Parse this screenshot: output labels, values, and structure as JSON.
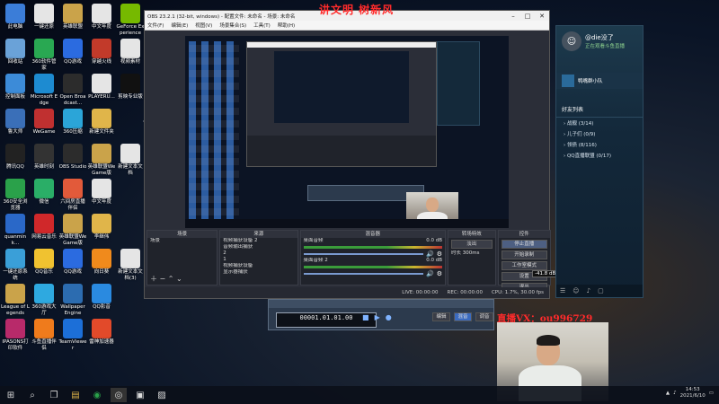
{
  "watermark_top": "讲文明 树新风",
  "watermark_vx": "直播VX：ou996729",
  "desktop_icons": [
    {
      "label": "此电脑",
      "icon": "computer-icon",
      "color": "#3b7dd8"
    },
    {
      "label": "一键还原",
      "icon": "file-icon",
      "color": "#e5e5e5"
    },
    {
      "label": "英雄联盟",
      "icon": "game-icon",
      "color": "#caa34a"
    },
    {
      "label": "中文年度",
      "icon": "file-icon",
      "color": "#e5e5e5"
    },
    {
      "label": "GeForce Experience",
      "icon": "nvidia-icon",
      "color": "#76b900"
    },
    {
      "label": "回收站",
      "icon": "recycle-bin-icon",
      "color": "#6aa2d8"
    },
    {
      "label": "360软件管家",
      "icon": "app-icon",
      "color": "#29a852"
    },
    {
      "label": "QQ游戏",
      "icon": "app-icon",
      "color": "#2b6be0"
    },
    {
      "label": "穿越火线",
      "icon": "game-icon",
      "color": "#c23a2a"
    },
    {
      "label": "视频素材",
      "icon": "file-icon",
      "color": "#e5e5e5"
    },
    {
      "label": "控制面板",
      "icon": "control-panel-icon",
      "color": "#3c8bd8"
    },
    {
      "label": "Microsoft Edge",
      "icon": "edge-icon",
      "color": "#1d8bd1"
    },
    {
      "label": "Open Broadcast...",
      "icon": "obs-icon",
      "color": "#2c2c2c"
    },
    {
      "label": "PLAYERU...",
      "icon": "file-icon",
      "color": "#e5e5e5"
    },
    {
      "label": "剪映专业版",
      "icon": "capcut-icon",
      "color": "#111111"
    },
    {
      "label": "鲁大师",
      "icon": "app-icon",
      "color": "#3a6fb8"
    },
    {
      "label": "WeGame",
      "icon": "app-icon",
      "color": "#c03030"
    },
    {
      "label": "360压缩",
      "icon": "app-icon",
      "color": "#2ba5d8"
    },
    {
      "label": "新建文件夹",
      "icon": "folder-icon",
      "color": "#e0b54a"
    },
    {
      "label": "",
      "icon": "blank",
      "color": "transparent"
    },
    {
      "label": "腾讯QQ",
      "icon": "qq-icon",
      "color": "#222"
    },
    {
      "label": "英雄时刻",
      "icon": "app-icon",
      "color": "#333"
    },
    {
      "label": "OBS Studio",
      "icon": "obs-icon",
      "color": "#2c2c2c"
    },
    {
      "label": "英雄联盟WeGame版",
      "icon": "game-icon",
      "color": "#caa34a"
    },
    {
      "label": "新建文本文档",
      "icon": "file-icon",
      "color": "#e5e5e5"
    },
    {
      "label": "360安全浏览器",
      "icon": "app-icon",
      "color": "#2aa14a"
    },
    {
      "label": "微信",
      "icon": "wechat-icon",
      "color": "#2aae67"
    },
    {
      "label": "六间房直播伴侣",
      "icon": "app-icon",
      "color": "#e25a3a"
    },
    {
      "label": "中文年度",
      "icon": "file-icon",
      "color": "#e5e5e5"
    },
    {
      "label": "",
      "icon": "blank",
      "color": "transparent"
    },
    {
      "label": "quanmink...",
      "icon": "app-icon",
      "color": "#2a68c8"
    },
    {
      "label": "网易云音乐",
      "icon": "music-icon",
      "color": "#d0282a"
    },
    {
      "label": "英雄联盟WeGame版",
      "icon": "game-icon",
      "color": "#caa34a"
    },
    {
      "label": "李继伟",
      "icon": "file-icon",
      "color": "#e0b54a"
    },
    {
      "label": "",
      "icon": "blank",
      "color": "transparent"
    },
    {
      "label": "一键还原系统",
      "icon": "app-icon",
      "color": "#3a9fd8"
    },
    {
      "label": "QQ音乐",
      "icon": "music-icon",
      "color": "#f0c230"
    },
    {
      "label": "QQ游戏",
      "icon": "app-icon",
      "color": "#2b6be0"
    },
    {
      "label": "向日葵",
      "icon": "app-icon",
      "color": "#f08a1c"
    },
    {
      "label": "新建文本文档(3)",
      "icon": "file-icon",
      "color": "#e5e5e5"
    },
    {
      "label": "League of Legends",
      "icon": "game-icon",
      "color": "#caa34a"
    },
    {
      "label": "360游戏大厅",
      "icon": "app-icon",
      "color": "#2ea9e0"
    },
    {
      "label": "Wallpaper Engine",
      "icon": "app-icon",
      "color": "#2c6cb0"
    },
    {
      "label": "QQ影音",
      "icon": "app-icon",
      "color": "#2a8ae0"
    },
    {
      "label": "",
      "icon": "blank",
      "color": "transparent"
    },
    {
      "label": "IPASONS打印软件",
      "icon": "app-icon",
      "color": "#b82a6a"
    },
    {
      "label": "斗鱼直播伴侣",
      "icon": "app-icon",
      "color": "#ef7b1c"
    },
    {
      "label": "TeamViewer",
      "icon": "app-icon",
      "color": "#1c6fd8"
    },
    {
      "label": "雷神加速器",
      "icon": "app-icon",
      "color": "#e24a2a"
    }
  ],
  "obs": {
    "title": "OBS 23.2.1 (32-bit, windows) - 配置文件: 未命名 - 场景: 未命名",
    "menu": [
      "文件(F)",
      "编辑(E)",
      "视图(V)",
      "场景集合(S)",
      "工具(T)",
      "帮助(H)"
    ],
    "docks": {
      "scenes": {
        "header": "场景",
        "items": [
          "场景"
        ]
      },
      "sources": {
        "header": "来源",
        "items": [
          "视频捕获设备 2",
          "音频输出捕获",
          "2",
          "1",
          "视频捕获设备",
          "显示器捕获"
        ]
      },
      "mixer": {
        "header": "混音器",
        "tracks": [
          {
            "name": "桌面音频",
            "db": "0.0 dB"
          },
          {
            "name": "桌面音频 2",
            "db": "0.0 dB"
          }
        ]
      },
      "transitions": {
        "header": "转场特效",
        "mode": "淡出",
        "duration_label": "时长",
        "duration": "300ms"
      },
      "controls": {
        "header": "控件",
        "buttons": [
          "停止直播",
          "开始录制",
          "工作室模式",
          "设置",
          "退出"
        ],
        "overlay": "-41.8 dB"
      }
    },
    "status": {
      "live": "LIVE: 00:00:00",
      "rec": "REC: 00:00:00",
      "cpu": "CPU: 1.7%, 30.00 fps"
    }
  },
  "qq_panel": {
    "name": "@die没了",
    "status": "正在观看斗鱼直播",
    "group_title": "鸭嘴群小队",
    "section": "好友列表",
    "groups": [
      "战舰 (3/14)",
      "儿子们 (0/9)",
      "领债 (8/116)",
      "QQ直播联盟 (0/17)"
    ]
  },
  "player": {
    "counter": "00001.01.01.00",
    "buttons": [
      "编辑",
      "混音",
      "调音"
    ]
  },
  "taskbar": {
    "time": "14:53",
    "date": "2021/6/10"
  }
}
